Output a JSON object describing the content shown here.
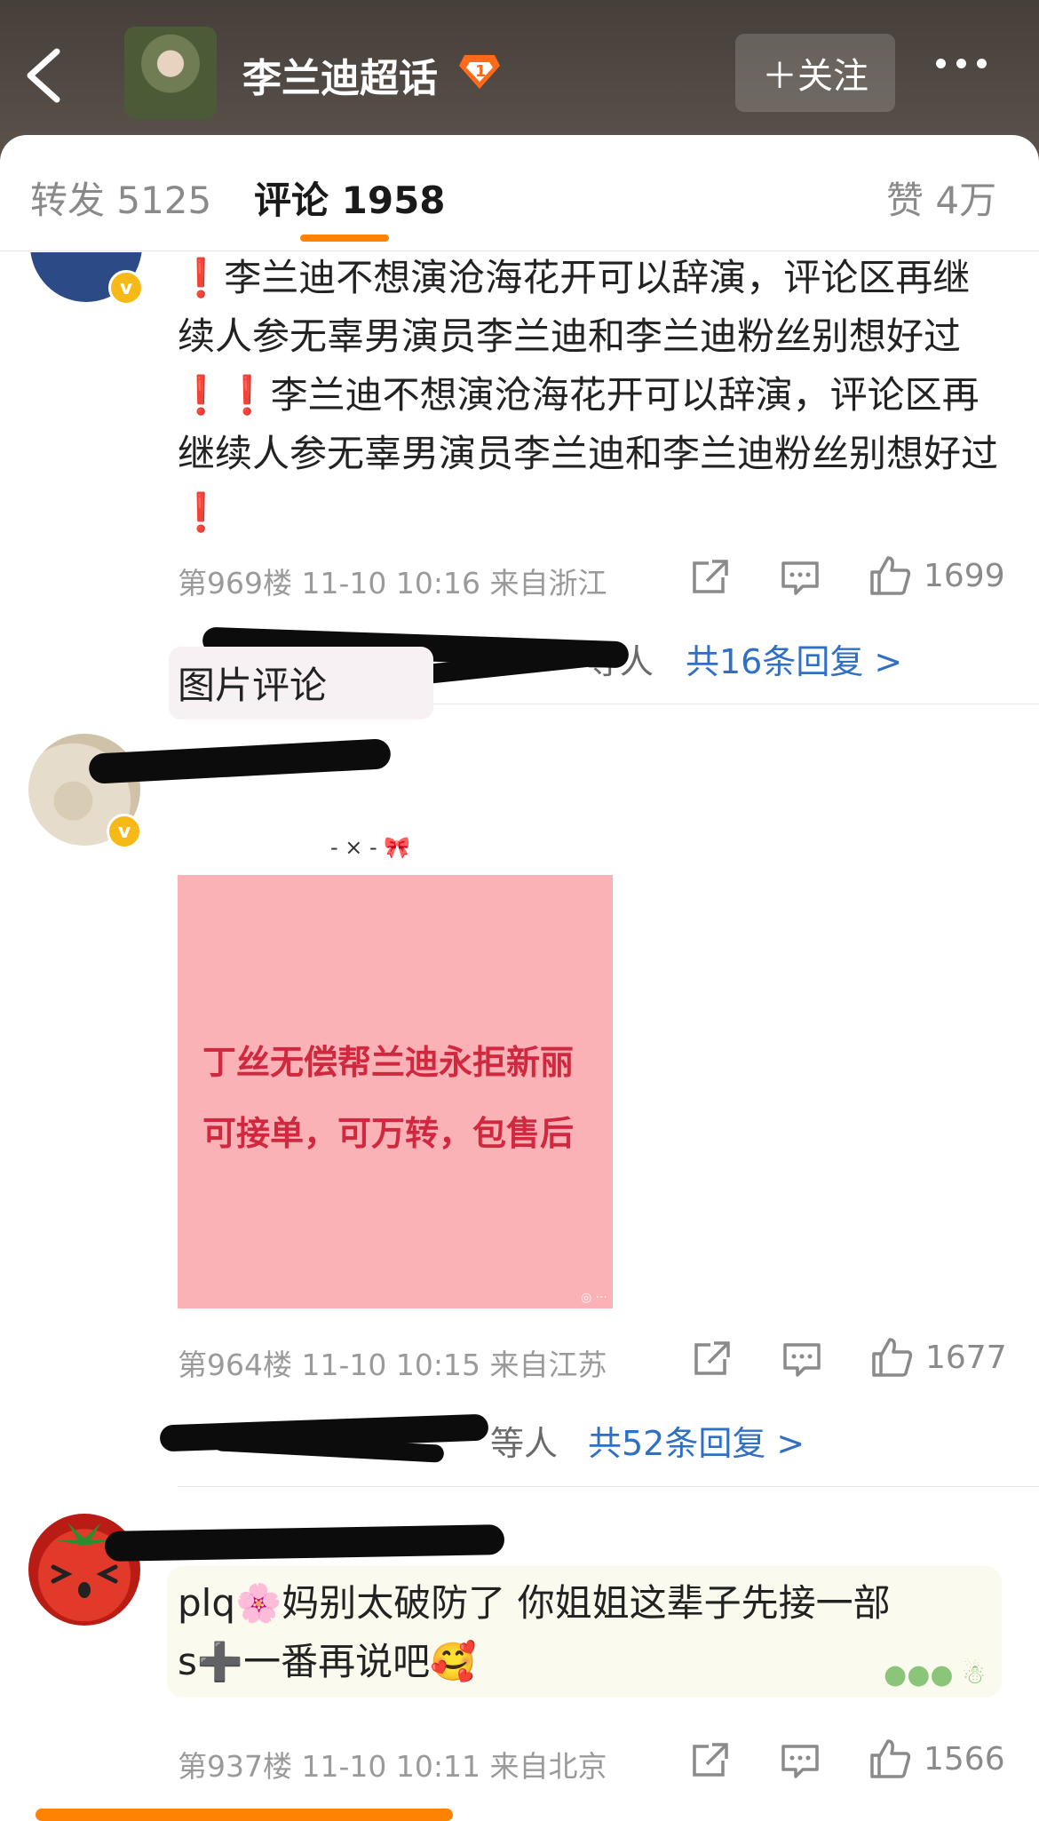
{
  "header": {
    "title": "李兰迪超话",
    "follow_label": "＋关注"
  },
  "tabs": {
    "repost": "转发 5125",
    "comments": "评论 1958",
    "likes": "赞 4万"
  },
  "comments": [
    {
      "text_part1": "李兰迪不想演沧海花开可以辞演，评论区再继续人参无辜男演员李兰迪和李兰迪粉丝别想好过",
      "text_part2": "李兰迪不想演沧海花开可以辞演，评论区再继续人参无辜男演员李兰迪和李兰迪粉丝别想好过",
      "meta": "第969楼 11-10 10:16 来自浙江",
      "likes": "1699",
      "reply_people_suffix": "等人",
      "replies": "共16条回复 >"
    },
    {
      "text": "图片评论",
      "image_line1": "丁丝无偿帮兰迪永拒新丽",
      "image_line2": "可接单，可万转，包售后",
      "meta": "第964楼 11-10 10:15 来自江苏",
      "likes": "1677",
      "reply_people_suffix": "等人",
      "replies": "共52条回复 >"
    },
    {
      "text_line1": "plq🌸妈别太破防了 你姐姐这辈子先接一部",
      "text_line2": "s➕一番再说吧🥰",
      "meta": "第937楼 11-10 10:11 来自北京",
      "likes": "1566"
    }
  ],
  "icons": {
    "back": "chevron-left-icon",
    "vip": "super-topic-badge-icon",
    "more": "more-dots-icon",
    "share": "share-icon",
    "comment": "comment-icon",
    "like": "thumbs-up-icon",
    "verified": "verified-v-icon"
  },
  "colors": {
    "accent": "#ff8200",
    "link": "#2f70c5",
    "exclaim": "#e02020"
  }
}
